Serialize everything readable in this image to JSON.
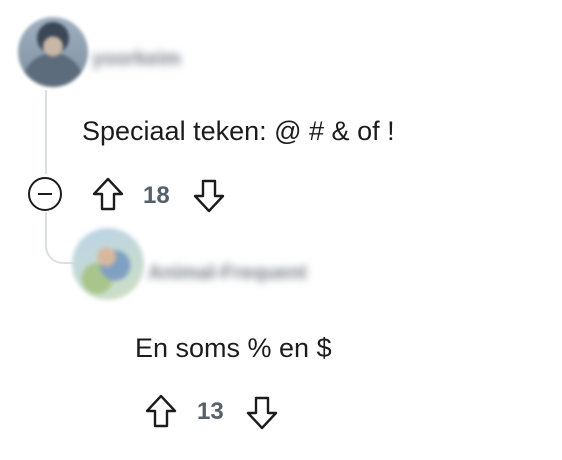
{
  "comments": [
    {
      "username": "yoorkeim",
      "text": "Speciaal teken: @ # & of !",
      "votes": "18"
    },
    {
      "username": "Animal-Frequent",
      "text": "En soms % en $",
      "votes": "13"
    }
  ],
  "icons": {
    "upvote": "arrow-up-outline",
    "downvote": "arrow-down-outline",
    "collapse": "minus-circle"
  },
  "colors": {
    "text": "#1c1c1c",
    "muted": "#576069",
    "thread_line": "#dcdfe3"
  }
}
